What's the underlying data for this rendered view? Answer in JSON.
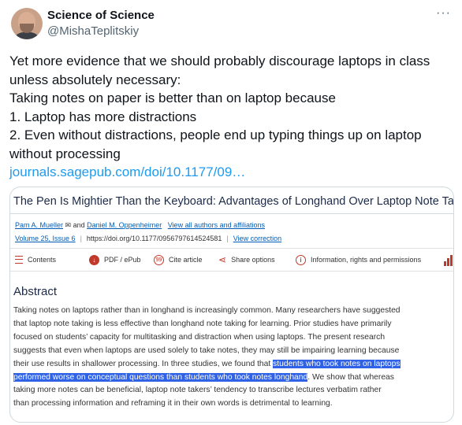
{
  "author": {
    "display_name": "Science of Science",
    "handle": "@MishaTeplitskiy",
    "more_icon": "more-horizontal-icon"
  },
  "tweet": {
    "lines": [
      "Yet more evidence that we should probably discourage laptops in class",
      "unless absolutely necessary:",
      "Taking notes on paper is better than on laptop because",
      "1. Laptop has more distractions",
      "2. Even without distractions, people end up typing things up on laptop",
      "without processing"
    ],
    "link": "journals.sagepub.com/doi/10.1177/09…"
  },
  "article": {
    "title": "The Pen Is Mightier Than the Keyboard: Advantages of Longhand Over Laptop Note Taking",
    "author1": "Pam A. Mueller",
    "and_text": "and",
    "author2": "Daniel M. Oppenheimer",
    "all_authors_link": "View all authors and affiliations",
    "volume": "Volume 25, Issue 6",
    "doi": "https://doi.org/10.1177/0956797614524581",
    "view_correction": "View correction",
    "toolbar": {
      "contents": "Contents",
      "pdf": "PDF / ePub",
      "cite": "Cite article",
      "share": "Share options",
      "info": "Information, rights and permissions"
    },
    "abstract_heading": "Abstract",
    "abstract": {
      "l1": "Taking notes on laptops rather than in longhand is increasingly common. Many researchers have suggested",
      "l2": "that laptop note taking is less effective than longhand note taking for learning. Prior studies have primarily",
      "l3": "focused on students’ capacity for multitasking and distraction when using laptops. The present research",
      "l4": "suggests that even when laptops are used solely to take notes, they may still be impairing learning because",
      "l5_pre": "their use results in shallower processing. In three studies, we found that ",
      "l5_hl": "students who took notes on laptops",
      "l6_hl": "performed worse on conceptual questions than students who took notes longhand",
      "l6_post": ". We show that whereas",
      "l7": "taking more notes can be beneficial, laptop note takers’ tendency to transcribe lectures verbatim rather",
      "l8": "than processing information and reframing it in their own words is detrimental to learning."
    }
  },
  "colors": {
    "link": "#1d9bf0",
    "highlight": "#2f62e6",
    "accent_red": "#c0392b",
    "journal_link": "#005eb8"
  }
}
